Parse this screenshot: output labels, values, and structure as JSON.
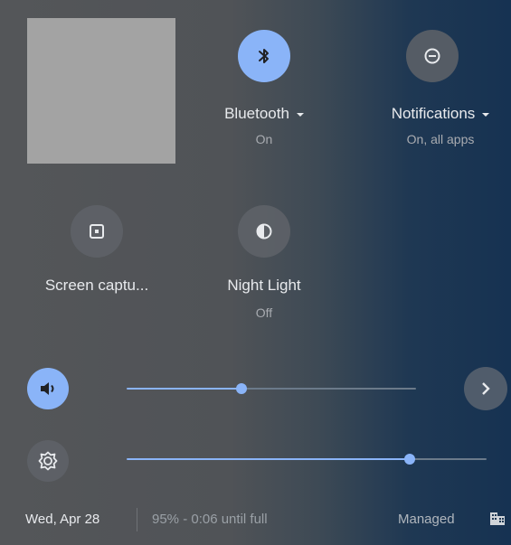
{
  "pods": {
    "bluetooth": {
      "label": "Bluetooth",
      "sub": "On",
      "icon": "bluetooth-icon"
    },
    "notifications": {
      "label": "Notifications",
      "sub": "On, all apps",
      "icon": "do-not-disturb-icon"
    },
    "screen_capture": {
      "label": "Screen captu...",
      "icon": "screen-capture-icon"
    },
    "night_light": {
      "label": "Night Light",
      "sub": "Off",
      "icon": "night-light-icon"
    }
  },
  "volume": {
    "icon": "volume-icon",
    "level": 0.35
  },
  "brightness": {
    "icon": "brightness-icon",
    "level": 0.78
  },
  "footer": {
    "date": "Wed, Apr 28",
    "battery": "95% - 0:06 until full",
    "managed": "Managed"
  },
  "colors": {
    "accent": "#8ab4f8",
    "pod_off": "#5f6368",
    "track_inactive": "#6b7a8a"
  }
}
